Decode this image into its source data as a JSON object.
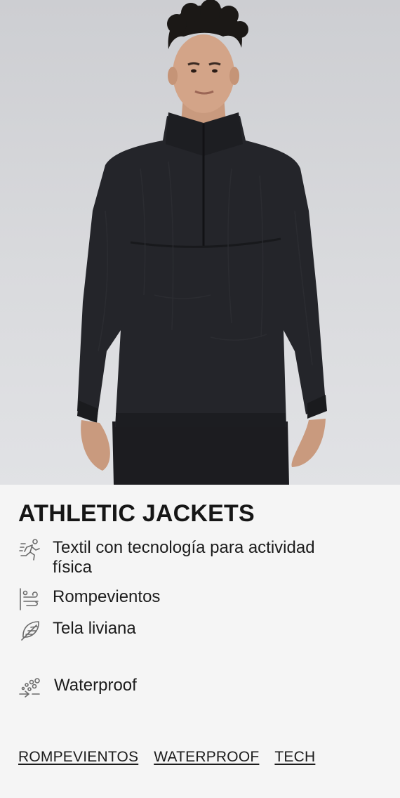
{
  "product": {
    "image_alt": "Model wearing black athletic jacket",
    "title": "ATHLETIC JACKETS"
  },
  "features": [
    {
      "icon": "running-person-icon",
      "label": "Textil con tecnología para actividad física"
    },
    {
      "icon": "wind-icon",
      "label": "Rompevientos"
    },
    {
      "icon": "feather-icon",
      "label": "Tela liviana"
    },
    {
      "icon": "water-drops-icon",
      "label": "Waterproof"
    }
  ],
  "tags": [
    "ROMPEVIENTOS",
    "WATERPROOF",
    "TECH"
  ],
  "colors": {
    "background": "#f5f5f5",
    "text": "#1a1a1a",
    "icon": "#6b6b6b"
  }
}
